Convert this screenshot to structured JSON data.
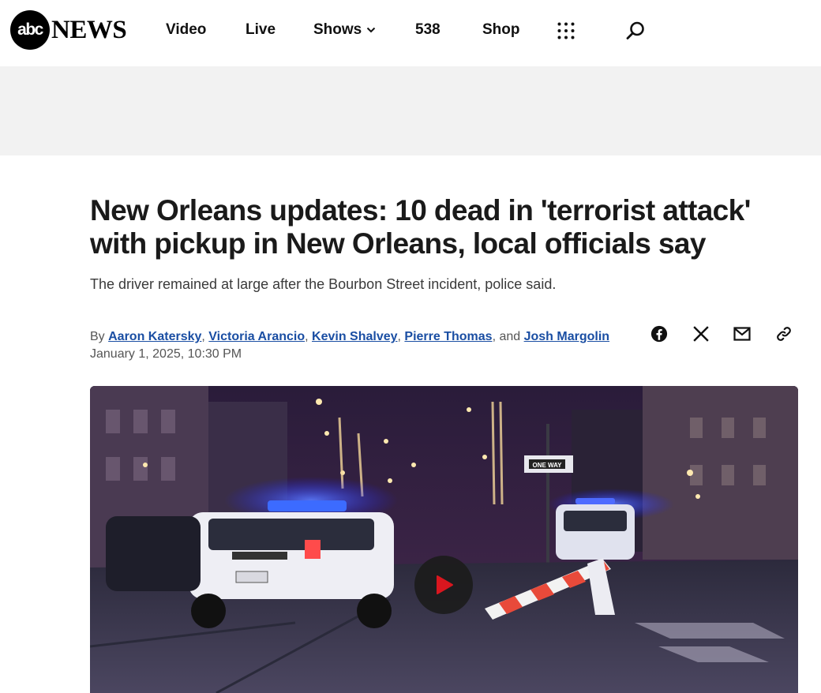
{
  "brand": {
    "logo_mark": "abc",
    "logo_word": "NEWS"
  },
  "nav": {
    "items": [
      {
        "label": "Video"
      },
      {
        "label": "Live"
      },
      {
        "label": "Shows",
        "has_dropdown": true
      },
      {
        "label": "538"
      },
      {
        "label": "Shop"
      }
    ],
    "more_icon": "grid-dots-icon",
    "search_icon": "search-icon"
  },
  "article": {
    "headline": "New Orleans updates: 10 dead in 'terrorist attack' with pickup in New Orleans, local officials say",
    "subhead": "The driver remained at large after the Bourbon Street incident, police said.",
    "byline": {
      "prefix": "By",
      "authors": [
        "Aaron Katersky",
        "Victoria Arancio",
        "Kevin Shalvey",
        "Pierre Thomas",
        "Josh Margolin"
      ],
      "conjunction": "and"
    },
    "date": "January 1, 2025, 10:30 PM"
  },
  "share": {
    "icons": [
      "facebook-icon",
      "x-icon",
      "email-icon",
      "link-icon"
    ]
  },
  "media": {
    "type": "video",
    "play_icon": "play-icon",
    "street_sign": "ONE WAY"
  },
  "colors": {
    "link": "#1a4ea3",
    "play_accent": "#e8141c",
    "ad_band": "#f2f2f2"
  }
}
